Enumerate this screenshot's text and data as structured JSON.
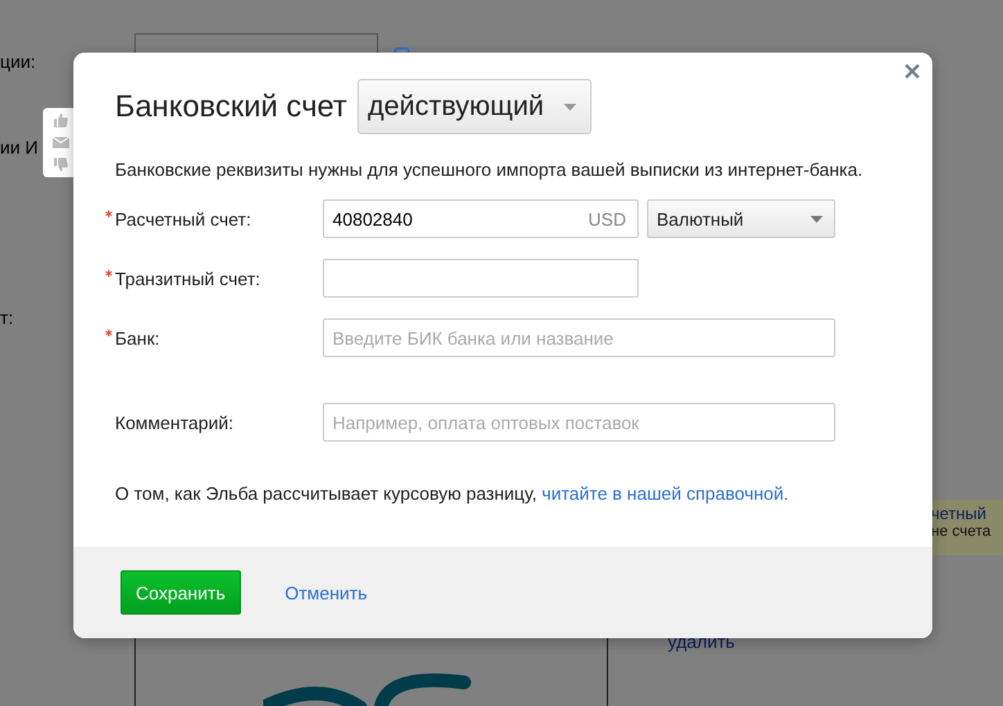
{
  "background_page": {
    "labels": [
      "ции:",
      "ии И",
      "т:"
    ],
    "notice": {
      "link": "четный",
      "text": "не счета"
    },
    "delete_link": "удалить"
  },
  "modal": {
    "title": "Банковский счет",
    "status_dropdown": "действующий",
    "intro": "Банковские реквизиты нужны для успешного импорта вашей выписки из интернет-банка.",
    "fields": [
      {
        "kind": "account",
        "label": "Расчетный счет:",
        "required": true,
        "value": "40802840",
        "currency": "USD",
        "type_dropdown": "Валютный"
      },
      {
        "kind": "short",
        "label": "Транзитный счет:",
        "required": true
      },
      {
        "kind": "wide",
        "label": "Банк:",
        "required": true,
        "placeholder": "Введите БИК банка или название"
      },
      {
        "kind": "wide",
        "label": "Комментарий:",
        "required": false,
        "placeholder": "Например, оплата оптовых поставок"
      }
    ],
    "note": {
      "text": "О том, как Эльба рассчитывает курсовую разницу,",
      "link": "читайте в нашей справочной."
    },
    "save_button": "Сохранить",
    "cancel_link": "Отменить"
  }
}
